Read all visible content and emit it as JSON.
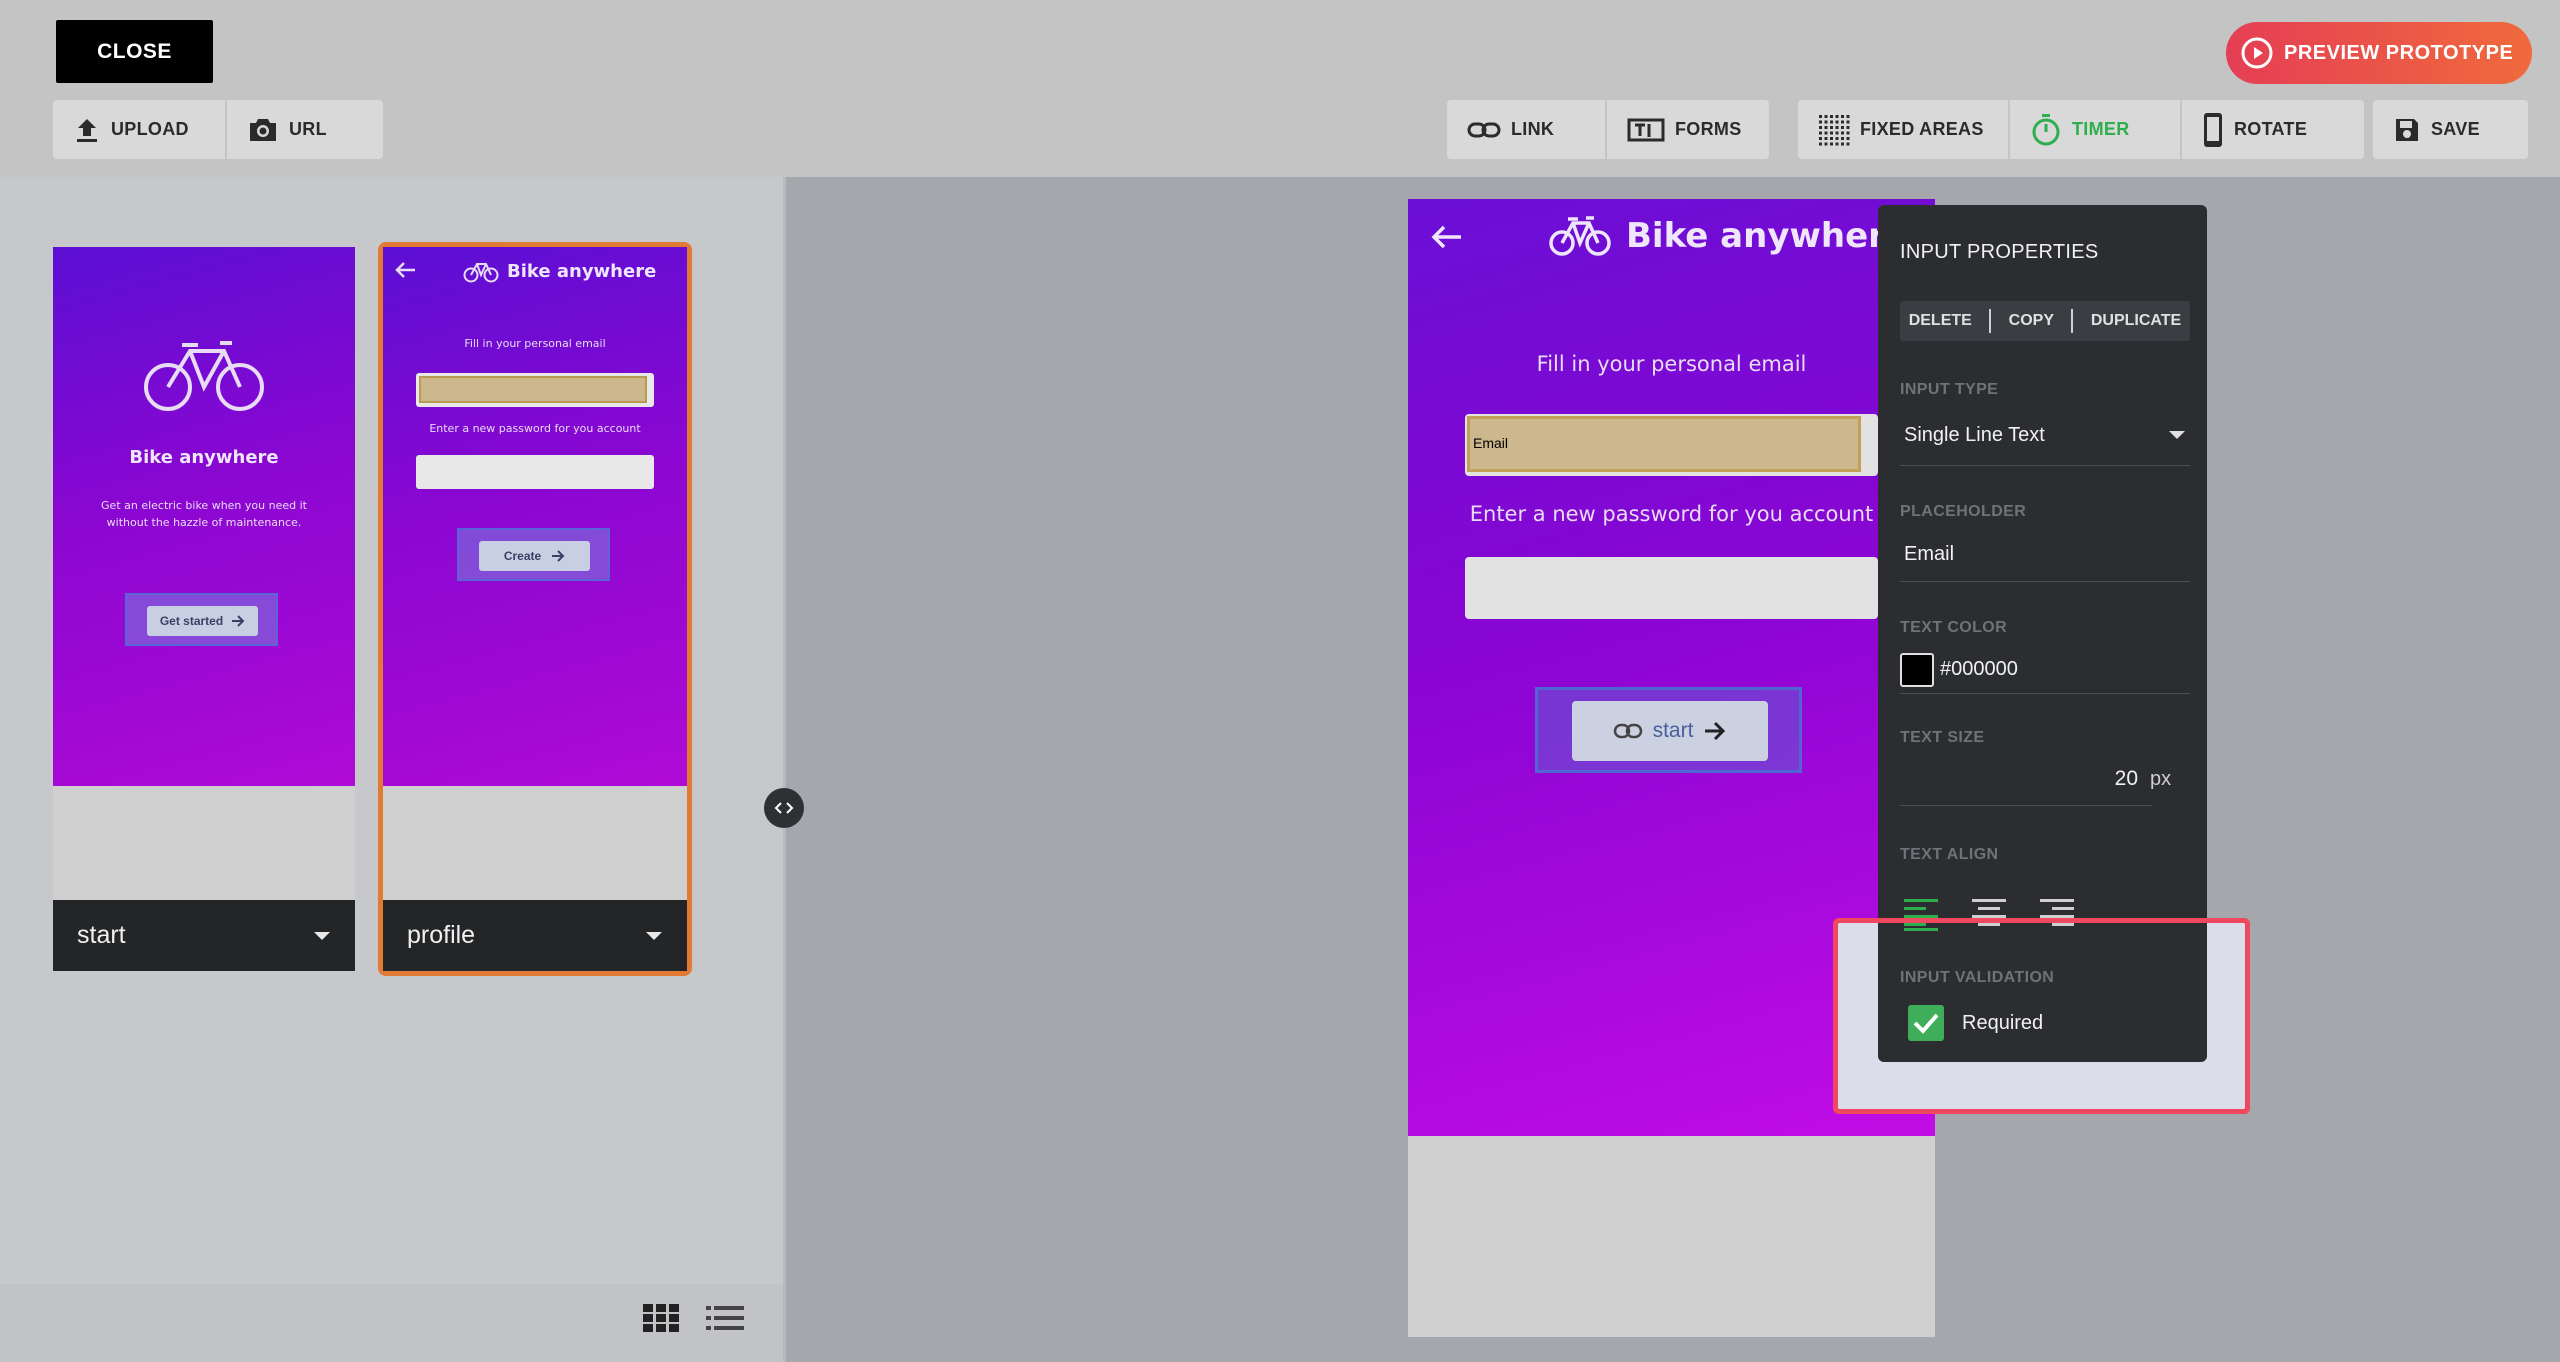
{
  "toolbar": {
    "close_label": "CLOSE",
    "preview_label": "PREVIEW PROTOTYPE",
    "upload_label": "UPLOAD",
    "url_label": "URL",
    "link_label": "LINK",
    "forms_label": "FORMS",
    "fixed_areas_label": "FIXED AREAS",
    "timer_label": "TIMER",
    "rotate_label": "ROTATE",
    "save_label": "SAVE",
    "accent_color": "#e53e55",
    "active_color": "#2fae4e"
  },
  "screens": [
    {
      "name": "start",
      "app_title": "Bike anywhere",
      "subtitle_line1": "Get an electric bike when you need it",
      "subtitle_line2": "without the hazzle of maintenance.",
      "button_label": "Get started"
    },
    {
      "name": "profile",
      "app_title": "Bike anywhere",
      "email_prompt": "Fill in your personal email",
      "password_prompt": "Enter a new password for you account",
      "button_label": "Create",
      "selected": true
    }
  ],
  "canvas": {
    "app_title": "Bike anywhere",
    "email_prompt": "Fill in your personal email",
    "email_placeholder": "Email",
    "password_prompt": "Enter a new password for you account",
    "link_target_label": "start"
  },
  "properties": {
    "title": "INPUT PROPERTIES",
    "delete_label": "DELETE",
    "copy_label": "COPY",
    "duplicate_label": "DUPLICATE",
    "input_type_label": "INPUT TYPE",
    "input_type_value": "Single Line Text",
    "placeholder_label": "PLACEHOLDER",
    "placeholder_value": "Email",
    "text_color_label": "TEXT COLOR",
    "text_color_value": "#000000",
    "text_size_label": "TEXT SIZE",
    "text_size_value": "20",
    "text_size_unit": "px",
    "text_align_label": "TEXT ALIGN",
    "validation_label": "INPUT VALIDATION",
    "required_label": "Required",
    "required_checked": true
  }
}
